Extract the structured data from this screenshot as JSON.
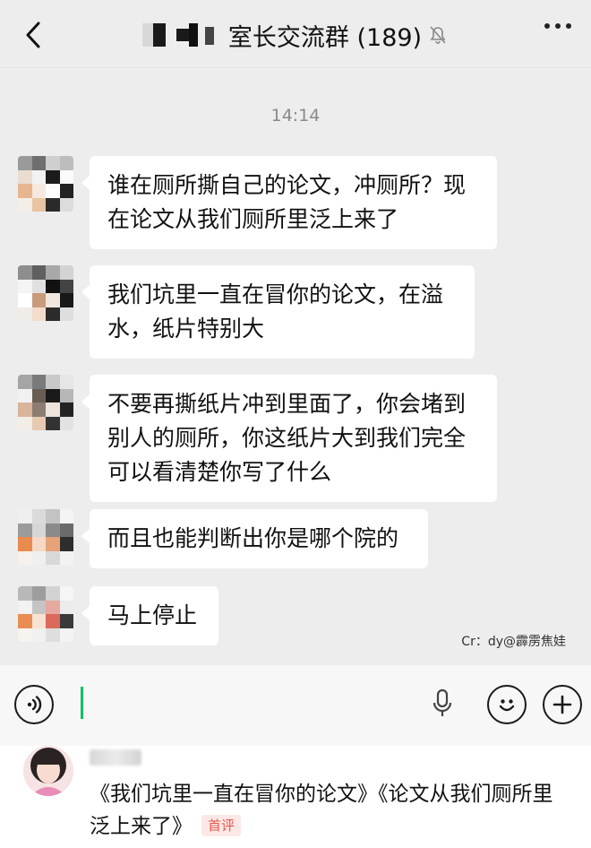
{
  "header": {
    "title": "室长交流群 (189)",
    "icons": {
      "back": "back-chevron-icon",
      "mute": "muted-bell-icon",
      "more": "more-dots-icon"
    }
  },
  "timestamp": "14:14",
  "messages": [
    {
      "text": "谁在厕所撕自己的论文，冲厕所？现在论文从我们厕所里泛上来了"
    },
    {
      "text": "我们坑里一直在冒你的论文，在溢水，纸片特别大"
    },
    {
      "text": "不要再撕纸片冲到里面了，你会堵到别人的厕所，你这纸片大到我们完全可以看清楚你写了什么"
    },
    {
      "text": "而且也能判断出你是哪个院的"
    },
    {
      "text": "马上停止"
    }
  ],
  "credit": "Cr：dy@霹雳焦娃",
  "input_bar": {
    "icons": {
      "voice": "voice-toggle-icon",
      "mic": "microphone-icon",
      "emoji": "emoji-icon",
      "add": "plus-icon"
    }
  },
  "comment": {
    "text": "《我们坑里一直在冒你的论文》《论文从我们厕所里泛上来了》",
    "badge": "首评"
  },
  "colors": {
    "accent": "#07c160",
    "badge": "#e4574e",
    "chat_bg": "#ededed"
  }
}
